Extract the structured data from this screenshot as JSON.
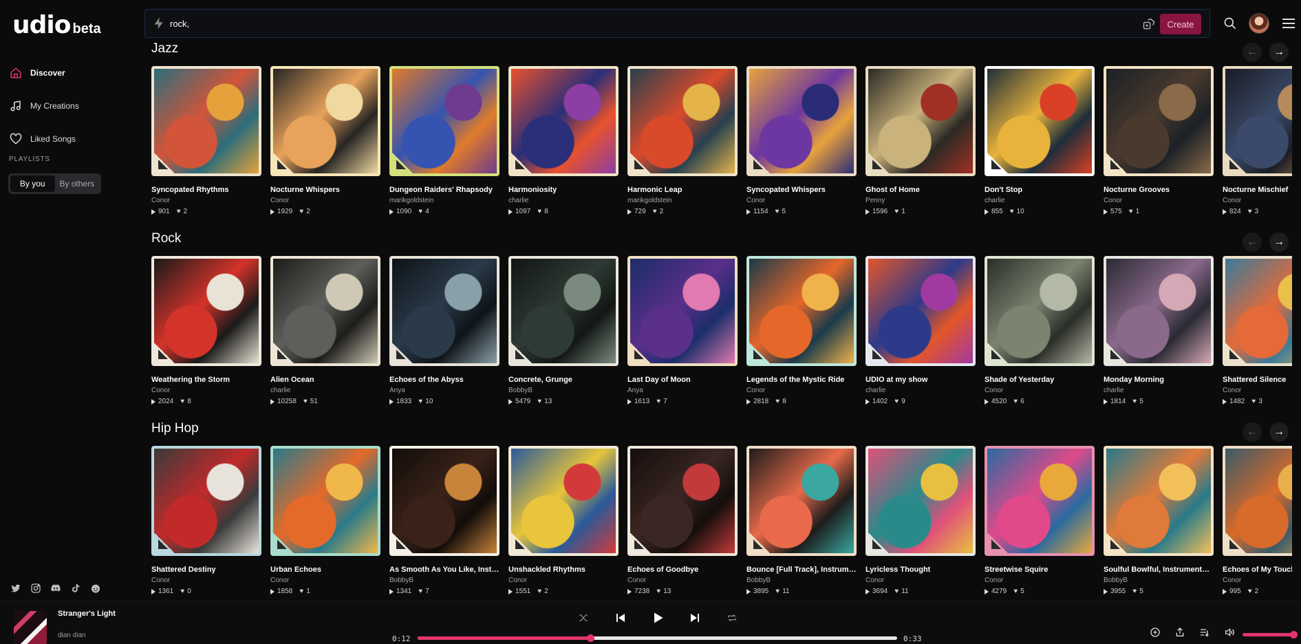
{
  "logo": {
    "main": "udio",
    "beta": "beta"
  },
  "nav": [
    {
      "label": "Discover",
      "icon": "home-icon",
      "active": true
    },
    {
      "label": "My Creations",
      "icon": "music-note-icon",
      "active": false
    },
    {
      "label": "Liked Songs",
      "icon": "heart-icon",
      "active": false
    }
  ],
  "playlists": {
    "label": "PLAYLISTS",
    "tabs": [
      "By you",
      "By others"
    ],
    "selected": "By you"
  },
  "search": {
    "value": "rock,"
  },
  "create_label": "Create",
  "colors": {
    "accent": "#e3356b",
    "create_bg": "#8a1540"
  },
  "sections": [
    {
      "title": "Jazz",
      "cards": [
        {
          "title": "Syncopated Rhythms",
          "artist": "Conor",
          "plays": "901",
          "likes": "2",
          "art": [
            "#d2553a",
            "#2c6d7a",
            "#e5a23a",
            "#ede3cf"
          ]
        },
        {
          "title": "Nocturne Whispers",
          "artist": "Conor",
          "plays": "1929",
          "likes": "2",
          "art": [
            "#e8a25b",
            "#262524",
            "#f0d9a1",
            "#f6e6b8"
          ]
        },
        {
          "title": "Dungeon Raiders' Rhapsody",
          "artist": "marikgoldstein",
          "plays": "1090",
          "likes": "4",
          "art": [
            "#3553b0",
            "#e07b2a",
            "#6e3b8e",
            "#d5e07a"
          ]
        },
        {
          "title": "Harmoniosity",
          "artist": "charlie",
          "plays": "1097",
          "likes": "8",
          "art": [
            "#2b2e78",
            "#e8522e",
            "#8b3ea4",
            "#f1e3c5"
          ]
        },
        {
          "title": "Harmonic Leap",
          "artist": "marikgoldstein",
          "plays": "729",
          "likes": "2",
          "art": [
            "#d94a2b",
            "#27404e",
            "#e4b44b",
            "#efe3cb"
          ]
        },
        {
          "title": "Syncopated Whispers",
          "artist": "Conor",
          "plays": "1154",
          "likes": "5",
          "art": [
            "#6c37a0",
            "#e9a23b",
            "#2b2c77",
            "#ebdcc5"
          ]
        },
        {
          "title": "Ghost of Home",
          "artist": "Penny",
          "plays": "1596",
          "likes": "1",
          "art": [
            "#c9b27b",
            "#2b2a24",
            "#a13024",
            "#e9ddc1"
          ]
        },
        {
          "title": "Don't Stop",
          "artist": "charlie",
          "plays": "855",
          "likes": "10",
          "art": [
            "#e9b33b",
            "#1e2e3a",
            "#d94026",
            "#ffffff"
          ]
        },
        {
          "title": "Nocturne Grooves",
          "artist": "Conor",
          "plays": "575",
          "likes": "1",
          "art": [
            "#4a3a2e",
            "#1b2025",
            "#8a6a4a",
            "#f4e4c7"
          ]
        },
        {
          "title": "Nocturne Mischief",
          "artist": "Conor",
          "plays": "824",
          "likes": "3",
          "art": [
            "#3b4a6a",
            "#1a1c24",
            "#b78a5a",
            "#e9dac0"
          ]
        }
      ]
    },
    {
      "title": "Rock",
      "cards": [
        {
          "title": "Weathering the Storm",
          "artist": "Conor",
          "plays": "2024",
          "likes": "8",
          "art": [
            "#d4332a",
            "#1a1a1a",
            "#e9e3d6",
            "#efe9dc"
          ]
        },
        {
          "title": "Alien Ocean",
          "artist": "charlie",
          "plays": "10258",
          "likes": "51",
          "art": [
            "#5e5e5a",
            "#1c1c1a",
            "#cfc8b6",
            "#ede6d6"
          ]
        },
        {
          "title": "Echoes of the Abyss",
          "artist": "Anya",
          "plays": "1833",
          "likes": "10",
          "art": [
            "#2a3a4a",
            "#0e1418",
            "#8aa0a8",
            "#e8e4da"
          ]
        },
        {
          "title": "Concrete, Grunge",
          "artist": "BobbyB",
          "plays": "5479",
          "likes": "13",
          "art": [
            "#2e3a34",
            "#121614",
            "#7a8a7e",
            "#e9e6dc"
          ]
        },
        {
          "title": "Last Day of Moon",
          "artist": "Anya",
          "plays": "1613",
          "likes": "7",
          "art": [
            "#5a2f8a",
            "#1c2e6a",
            "#e07ab0",
            "#f0dfc0"
          ]
        },
        {
          "title": "Legends of the Mystic Ride",
          "artist": "Conor",
          "plays": "2818",
          "likes": "8",
          "art": [
            "#e5672a",
            "#1b3a4a",
            "#f0b24a",
            "#bfe6da"
          ]
        },
        {
          "title": "UDIO at my show",
          "artist": "charlie",
          "plays": "1402",
          "likes": "9",
          "art": [
            "#2d3a8a",
            "#e3562a",
            "#a13aa0",
            "#e6e8f0"
          ]
        },
        {
          "title": "Shade of Yesterday",
          "artist": "Conor",
          "plays": "4520",
          "likes": "6",
          "art": [
            "#7c8470",
            "#2a2e28",
            "#b4b8a6",
            "#dde4d2"
          ]
        },
        {
          "title": "Monday Morning",
          "artist": "charlie",
          "plays": "1814",
          "likes": "5",
          "art": [
            "#8a6a8a",
            "#2a2a34",
            "#d4a8b4",
            "#e6e8e0"
          ]
        },
        {
          "title": "Shattered Silence",
          "artist": "Conor",
          "plays": "1482",
          "likes": "3",
          "art": [
            "#e46a3a",
            "#3a7a9a",
            "#e8c04a",
            "#ece2cc"
          ]
        }
      ]
    },
    {
      "title": "Hip Hop",
      "cards": [
        {
          "title": "Shattered Destiny",
          "artist": "Conor",
          "plays": "1361",
          "likes": "0",
          "art": [
            "#c22a2a",
            "#3a3a3a",
            "#e8e4dc",
            "#b9d8e0"
          ]
        },
        {
          "title": "Urban Echoes",
          "artist": "Conor",
          "plays": "1858",
          "likes": "1",
          "art": [
            "#e46a2a",
            "#2a7a8a",
            "#f0b84a",
            "#a9dccc"
          ]
        },
        {
          "title": "As Smooth As You Like, Instrum...",
          "artist": "BobbyB",
          "plays": "1341",
          "likes": "7",
          "art": [
            "#3a2218",
            "#120c0a",
            "#c8843a",
            "#f4f0e6"
          ]
        },
        {
          "title": "Unshackled Rhythms",
          "artist": "Conor",
          "plays": "1551",
          "likes": "2",
          "art": [
            "#e8c53a",
            "#2a5a9a",
            "#d23a3a",
            "#f2ead6"
          ]
        },
        {
          "title": "Echoes of Goodbye",
          "artist": "Conor",
          "plays": "7238",
          "likes": "13",
          "art": [
            "#3a2622",
            "#140e0c",
            "#c23a3a",
            "#efe9dc"
          ]
        },
        {
          "title": "Bounce [Full Track], Instrument...",
          "artist": "BobbyB",
          "plays": "3895",
          "likes": "11",
          "art": [
            "#e86a4a",
            "#1c1c1c",
            "#3aa8a0",
            "#f0dfc6"
          ]
        },
        {
          "title": "Lyricless Thought",
          "artist": "Conor",
          "plays": "3694",
          "likes": "11",
          "art": [
            "#2a8a8a",
            "#e0507a",
            "#e8c040",
            "#e6e8e0"
          ]
        },
        {
          "title": "Streetwise Squire",
          "artist": "Conor",
          "plays": "4279",
          "likes": "5",
          "art": [
            "#e04a8a",
            "#2a6aa0",
            "#e8a83a",
            "#e890b0"
          ]
        },
        {
          "title": "Soulful Bowlful, Instrumental Hi...",
          "artist": "BobbyB",
          "plays": "3955",
          "likes": "5",
          "art": [
            "#e07a3a",
            "#2a7a8a",
            "#f2c05a",
            "#f4e4c6"
          ]
        },
        {
          "title": "Echoes of My Touch",
          "artist": "Conor",
          "plays": "995",
          "likes": "2",
          "art": [
            "#d86a2a",
            "#3a5a6a",
            "#e8b04a",
            "#eedfc6"
          ]
        }
      ]
    }
  ],
  "player": {
    "title": "Stranger's Light",
    "artist": "dian dian",
    "elapsed": "0:12",
    "duration": "0:33",
    "progress_pct": 36,
    "volume_pct": 100
  }
}
